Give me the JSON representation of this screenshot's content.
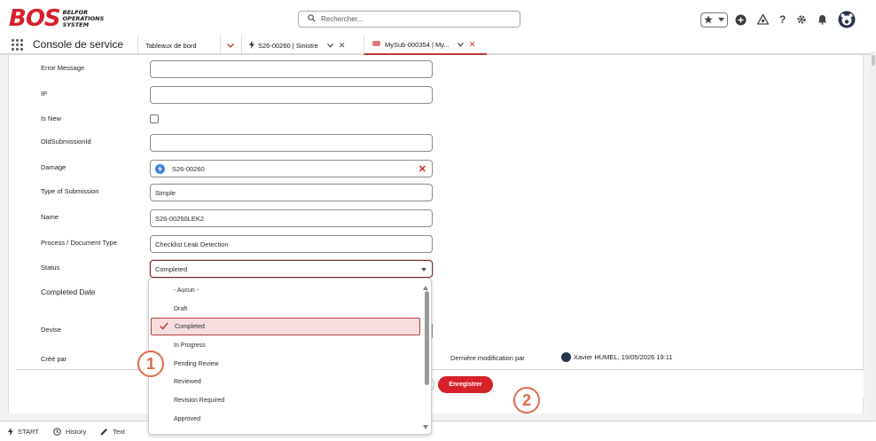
{
  "brand": {
    "logo_text": "BOS",
    "logo_sub_line1": "BELFOR",
    "logo_sub_line2": "OPERATIONS",
    "logo_sub_line3": "SYSTEM",
    "accent_color": "#d6202a"
  },
  "search": {
    "placeholder": "Rechercher..."
  },
  "nav": {
    "app_name": "Console de service",
    "tabs": [
      {
        "label": "Tableaux de bord"
      },
      {
        "label": "S26-00260 | Sinistre"
      },
      {
        "label": "MySub-000354 | My..."
      }
    ]
  },
  "form": {
    "fields": [
      {
        "label": "Error Message",
        "value": ""
      },
      {
        "label": "IP",
        "value": ""
      },
      {
        "label": "Is New",
        "value": ""
      },
      {
        "label": "OldSubmissionId",
        "value": ""
      },
      {
        "label": "Damage",
        "value": "S26-00260"
      },
      {
        "label": "Type of Submission",
        "value": "Simple"
      },
      {
        "label": "Name",
        "value": "S26-00260LEK2"
      },
      {
        "label": "Process / Document Type",
        "value": "Checklist Leak Detection"
      },
      {
        "label": "Status",
        "value": "Completed"
      },
      {
        "label": "Completed Date",
        "value": ""
      },
      {
        "label": "Devise",
        "value": ""
      },
      {
        "label": "Créé par",
        "value": ""
      }
    ],
    "last_modified_label": "Dernière modification par",
    "last_modified_value": "Xavier HUMEL, 19/05/2026 19:11"
  },
  "status_options": [
    "- Aucun -",
    "Draft",
    "Completed",
    "In Progress",
    "Pending Review",
    "Reviewed",
    "Revision Required",
    "Approved"
  ],
  "selected_status": "Completed",
  "actions": {
    "save_label": "Enregistrer"
  },
  "annotations": {
    "a1": "1",
    "a2": "2"
  },
  "utility": {
    "start": "START",
    "history": "History",
    "text": "Text"
  }
}
